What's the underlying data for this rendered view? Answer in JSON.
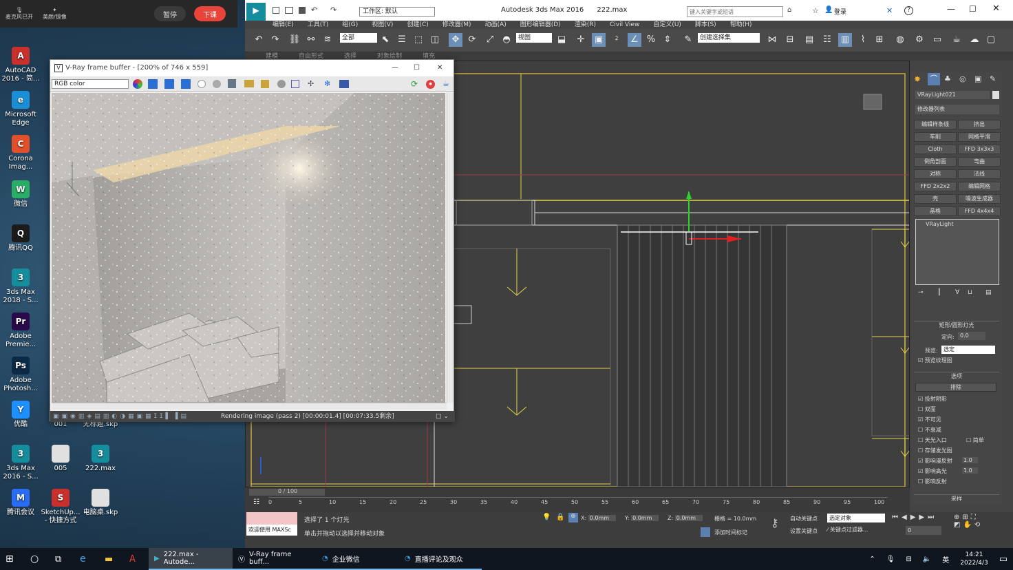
{
  "recorder": {
    "items": [
      {
        "label": "麦克风已开"
      },
      {
        "label": "美颜/镜像"
      }
    ],
    "pause_label": "暂停",
    "end_live_label": "下课"
  },
  "desktop_icons": [
    {
      "label": "AutoCAD 2016 - 简...",
      "color": "#c8302c",
      "glyph": "A"
    },
    {
      "label": "Microsoft Edge",
      "color": "#1b8fd6",
      "glyph": "e"
    },
    {
      "label": "Corona Imag...",
      "color": "#e0502a",
      "glyph": "C"
    },
    {
      "label": "微信",
      "color": "#2aae67",
      "glyph": "W"
    },
    {
      "label": "腾讯QQ",
      "color": "#1b1b1b",
      "glyph": "Q"
    },
    {
      "label": "3ds Max 2018 - S...",
      "color": "#168d9c",
      "glyph": "3"
    },
    {
      "label": "Adobe Premie...",
      "color": "#2a0a4a",
      "glyph": "Pr"
    },
    {
      "label": "Adobe Photosh...",
      "color": "#0b2a48",
      "glyph": "Ps"
    },
    {
      "label": "优酷",
      "color": "#1e90ff",
      "glyph": "Y"
    },
    {
      "label": "3ds Max 2016 - S...",
      "color": "#168d9c",
      "glyph": "3"
    },
    {
      "label": "腾讯会议",
      "color": "#2a6df4",
      "glyph": "M"
    },
    {
      "label": "001",
      "color": "#e0e0e0",
      "glyph": ""
    },
    {
      "label": "005",
      "color": "#e0e0e0",
      "glyph": ""
    },
    {
      "label": "SketchUp... - 快捷方式",
      "color": "#c8302c",
      "glyph": "S"
    },
    {
      "label": "无标题.skp",
      "color": "#e0e0e0",
      "glyph": ""
    },
    {
      "label": "222.max",
      "color": "#168d9c",
      "glyph": "3"
    },
    {
      "label": "电脑桌.skp",
      "color": "#e0e0e0",
      "glyph": ""
    }
  ],
  "max": {
    "app_title": "Autodesk 3ds Max 2016",
    "file_name": "222.max",
    "workspace_label": "工作区: 默认",
    "search_placeholder": "键入关键字或短语",
    "login_label": "登录",
    "menu": [
      "编辑(E)",
      "工具(T)",
      "组(G)",
      "视图(V)",
      "创建(C)",
      "修改器(M)",
      "动画(A)",
      "图形编辑器(D)",
      "渲染(R)",
      "Civil View",
      "自定义(U)",
      "脚本(S)",
      "帮助(H)"
    ],
    "selection_filter": "全部",
    "ref_coord": "视图",
    "named_selection": "创建选择集",
    "ribbon_tabs": [
      "建模",
      "自由形式",
      "选择",
      "对象绘制",
      "填充"
    ],
    "command_panel": {
      "object_name": "VRayLight021",
      "modifier_list": "修改器列表",
      "buttons": [
        "编辑样条线",
        "挤出",
        "车削",
        "网格平滑",
        "Cloth",
        "FFD 3x3x3",
        "倒角剖面",
        "弯曲",
        "对称",
        "法线",
        "FFD 2x2x2",
        "编辑网格",
        "壳",
        "噪波生成器",
        "晶格",
        "FFD 4x4x4"
      ],
      "stack_item": "VRayLight",
      "rollout_title": "矩形/圆形灯光",
      "directional_label": "定向:",
      "directional_value": "0.0",
      "preview_label": "预览:",
      "preview_value": "选定",
      "preview_texture": "预览纹理图",
      "options_title": "选项",
      "exclude_label": "排除",
      "options": [
        {
          "label": "投射阴影",
          "checked": true
        },
        {
          "label": "双面",
          "checked": false
        },
        {
          "label": "不可见",
          "checked": true
        },
        {
          "label": "不衰减",
          "checked": false
        },
        {
          "label": "天光入口",
          "checked": false
        },
        {
          "label": "存储发光图",
          "checked": false
        },
        {
          "label": "影响漫反射",
          "checked": true,
          "value": "1.0"
        },
        {
          "label": "影响高光",
          "checked": true,
          "value": "1.0"
        },
        {
          "label": "影响反射",
          "checked": false
        }
      ],
      "simple_label": "简单",
      "sampling_title": "采样"
    },
    "timeline": {
      "frame": "0 / 100",
      "ticks": [
        "0",
        "5",
        "10",
        "15",
        "20",
        "25",
        "30",
        "35",
        "40",
        "45",
        "50",
        "55",
        "60",
        "65",
        "70",
        "75",
        "80",
        "85",
        "90",
        "95",
        "100"
      ]
    },
    "status": {
      "maxscript": "欢迎使用 MAXSc",
      "selected": "选择了 1 个灯光",
      "prompt": "单击并拖动以选择并移动对象",
      "x_label": "X:",
      "x_value": "0.0mm",
      "y_label": "Y:",
      "y_value": "0.0mm",
      "z_label": "Z:",
      "z_value": "0.0mm",
      "grid": "栅格 = 10.0mm",
      "add_time_tag": "添加时间标记",
      "auto_key": "自动关键点",
      "set_key": "设置关键点",
      "selected_object": "选定对象",
      "key_filter": "关键点过滤器...",
      "frame_value": "0"
    }
  },
  "vray": {
    "title": "V-Ray frame buffer - [200% of 746 x 559]",
    "channel": "RGB color",
    "status": "Rendering image (pass 2) [00:00:01.4] [00:07:33.5剩余]"
  },
  "taskbar": {
    "items": [
      {
        "label": "222.max - Autode...",
        "state": "active"
      },
      {
        "label": "V-Ray frame buff...",
        "state": "open"
      },
      {
        "label": "企业微信",
        "state": "open"
      },
      {
        "label": "直播评论及观众",
        "state": "open"
      }
    ],
    "ime": "英",
    "time": "14:21",
    "date": "2022/4/3"
  }
}
